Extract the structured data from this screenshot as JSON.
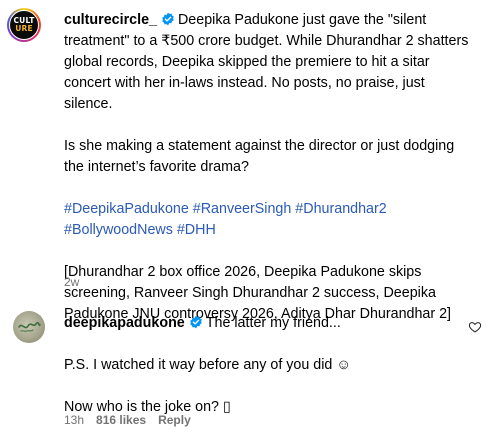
{
  "post_comment": {
    "avatar_text_line1": "CULT",
    "avatar_text_line2": "URE",
    "username": "culturecircle_",
    "text_line1": "Deepika Padukone just gave the \"silent",
    "text_rest": "treatment\" to a ₹500 crore budget. While Dhurandhar 2 shatters\nglobal records, Deepika skipped the premiere to hit a sitar\nconcert with her in-laws instead. No posts, no praise, just silence.\n\nIs she making a statement against the director or just dodging\nthe internet’s favorite drama?",
    "hashtags": "#DeepikaPadukone #RanveerSingh #Dhurandhar2\n#BollywoodNews #DHH",
    "keywords": "[Dhurandhar 2 box office 2026, Deepika Padukone skips\nscreening, Ranveer Singh Dhurandhar 2 success, Deepika\nPadukone JNU controversy 2026, Aditya Dhar Dhurandhar 2]",
    "time": "2w"
  },
  "reply": {
    "username": "deepikapadukone",
    "text_line1": "The latter my friend...",
    "text_rest": "P.S. I watched it way before any of you did ☺\n\nNow who is the joke on? ▯",
    "time": "13h",
    "likes": "816 likes",
    "reply_label": "Reply"
  },
  "colors": {
    "verified": "#0095f6",
    "hashtag": "#2b5ab7",
    "meta": "#737373"
  },
  "icons": [
    "verified-badge-icon",
    "heart-icon"
  ]
}
